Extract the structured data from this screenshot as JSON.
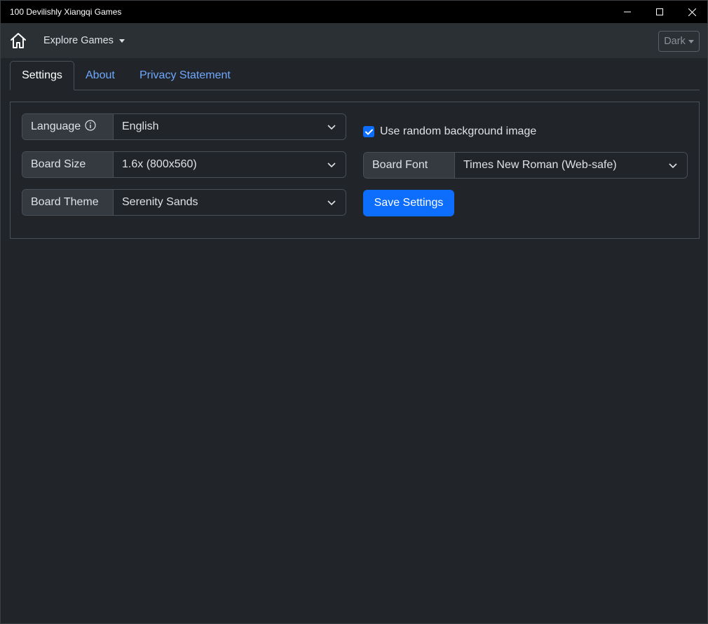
{
  "window": {
    "title": "100 Devilishly Xiangqi Games",
    "controls": [
      "minimize-icon",
      "maximize-icon",
      "close-icon"
    ]
  },
  "navbar": {
    "home_icon": "home-icon",
    "explore_label": "Explore Games",
    "theme_label": "Dark"
  },
  "tabs": [
    {
      "label": "Settings",
      "active": true
    },
    {
      "label": "About",
      "active": false
    },
    {
      "label": "Privacy Statement",
      "active": false
    }
  ],
  "settings": {
    "language": {
      "label": "Language",
      "value": "English",
      "icon": "info-icon"
    },
    "board_size": {
      "label": "Board Size",
      "value": "1.6x (800x560)"
    },
    "board_theme": {
      "label": "Board Theme",
      "value": "Serenity Sands"
    },
    "random_bg": {
      "label": "Use random background image",
      "checked": true
    },
    "board_font": {
      "label": "Board Font",
      "value": "Times New Roman (Web-safe)"
    },
    "save_label": "Save Settings"
  },
  "colors": {
    "accent": "#0d6efd",
    "link": "#6ea8fe",
    "background": "#212529",
    "navbar": "#2b3035",
    "titlebar": "#000000"
  }
}
